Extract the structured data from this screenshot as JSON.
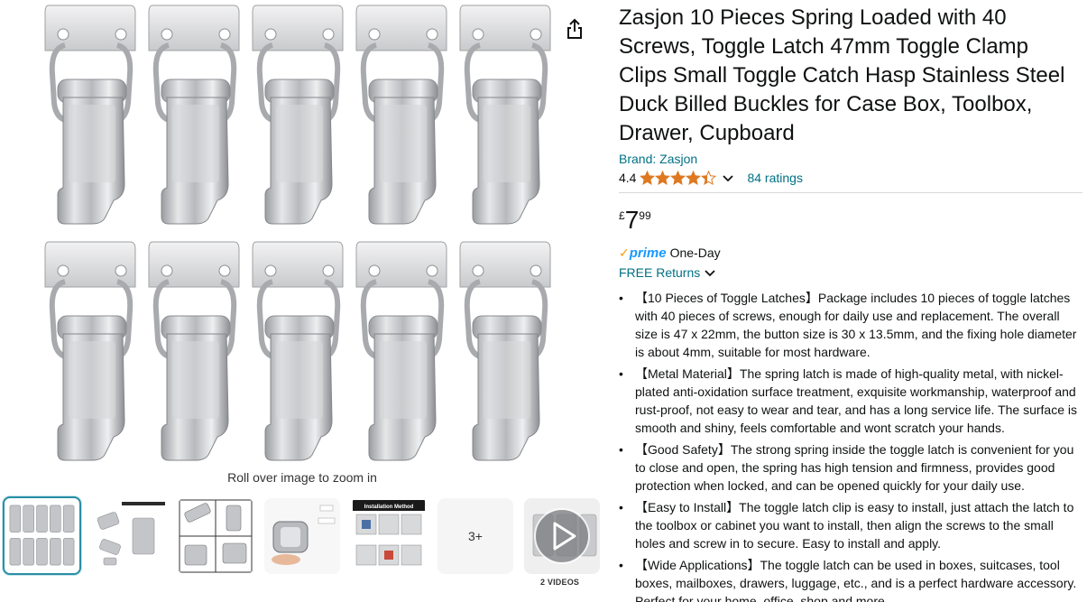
{
  "gallery": {
    "zoom_hint": "Roll over image to zoom in",
    "more_count": "3+",
    "videos_label": "2 VIDEOS",
    "thumb_labels": {
      "installation": "Installation Method"
    }
  },
  "product": {
    "title": "Zasjon 10 Pieces Spring Loaded with 40 Screws, Toggle Latch 47mm Toggle Clamp Clips Small Toggle Catch Hasp Stainless Steel Duck Billed Buckles for Case Box, Toolbox, Drawer, Cupboard",
    "brand": "Brand: Zasjon",
    "rating": "4.4",
    "stars": 4.4,
    "ratings_count": "84 ratings",
    "price": {
      "symbol": "£",
      "whole": "7",
      "fraction": "99"
    },
    "prime": {
      "check": "✓",
      "logo": "prime",
      "delivery": "One-Day"
    },
    "returns": "FREE Returns",
    "bullets": [
      "【10 Pieces of Toggle Latches】Package includes 10 pieces of toggle latches with 40 pieces of screws, enough for daily use and replacement. The overall size is 47 x 22mm, the button size is 30 x 13.5mm, and the fixing hole diameter is about 4mm, suitable for most hardware.",
      "【Metal Material】The spring latch is made of high-quality metal, with nickel-plated anti-oxidation surface treatment, exquisite workmanship, waterproof and rust-proof, not easy to wear and tear, and has a long service life. The surface is smooth and shiny, feels comfortable and wont scratch your hands.",
      "【Good Safety】The strong spring inside the toggle latch is convenient for you to close and open, the spring has high tension and firmness, provides good protection when locked, and can be opened quickly for your daily use.",
      "【Easy to Install】The toggle latch clip is easy to install, just attach the latch to the toolbox or cabinet you want to install, then align the screws to the small holes and screw in to secure. Easy to install and apply.",
      "【Wide Applications】The toggle latch can be used in boxes, suitcases, tool boxes, mailboxes, drawers, luggage, etc., and is a perfect hardware accessory. Perfect for your home, office, shop and more."
    ]
  },
  "icons": {
    "share": "share-icon",
    "star": "star-icon",
    "chevron": "chevron-down-icon",
    "play": "play-icon"
  },
  "colors": {
    "link": "#007185",
    "star": "#de7921",
    "prime_blue": "#1a98ff",
    "prime_check": "#ff9900",
    "thumb_selected_border": "#2a8ea5"
  }
}
